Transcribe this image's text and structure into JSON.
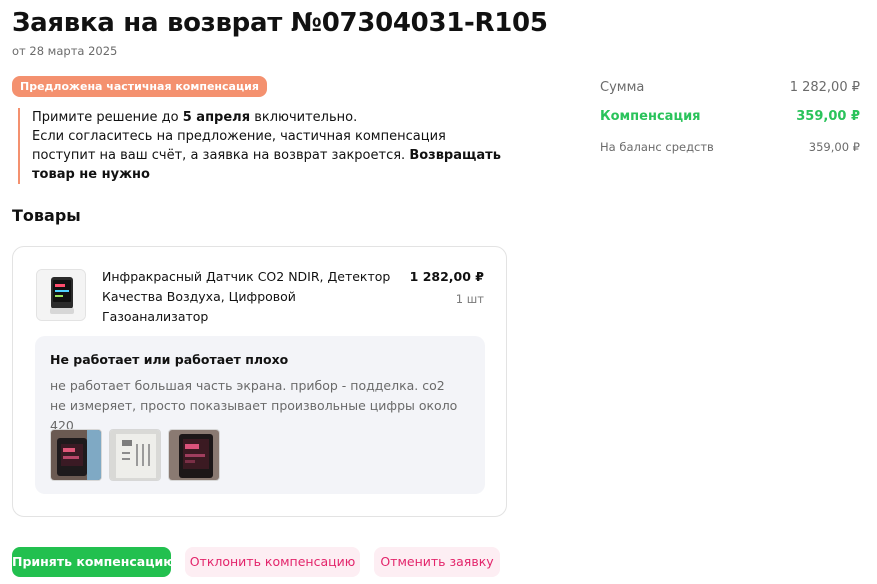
{
  "header": {
    "title": "Заявка на возврат №07304031-R105",
    "date": "от 28 марта 2025"
  },
  "status": {
    "badge": "Предложена частичная компенсация",
    "notice_line1_prefix": "Примите решение до ",
    "notice_deadline": "5 апреля",
    "notice_line1_suffix": " включительно.",
    "notice_body": "Если согласитесь на предложение, частичная компенсация поступит на ваш счёт, а заявка на возврат закроется. ",
    "notice_bold_tail": "Возвращать товар не нужно"
  },
  "products": {
    "section_title": "Товары",
    "items": [
      {
        "name": "Инфракрасный Датчик CO2 NDIR, Детектор Качества Воздуха, Цифровой Газоанализатор",
        "price": "1 282,00 ₽",
        "quantity": "1 шт",
        "reason_title": "Не работает или работает плохо",
        "reason_text": "не работает большая часть экрана. прибор - подделка. co2 не измеряет, просто показывает произвольные цифры около 420"
      }
    ]
  },
  "summary": {
    "rows": [
      {
        "label": "Сумма",
        "value": "1 282,00 ₽"
      },
      {
        "label": "Компенсация",
        "value": "359,00 ₽"
      },
      {
        "label": "На баланс средств",
        "value": "359,00 ₽"
      }
    ]
  },
  "actions": {
    "accept": "Принять компенсацию",
    "decline": "Отклонить компенсацию",
    "cancel": "Отменить заявку"
  },
  "colors": {
    "badge": "#f4916f",
    "accent_green": "#2ac35b",
    "accent_pink": "#e3256b"
  }
}
